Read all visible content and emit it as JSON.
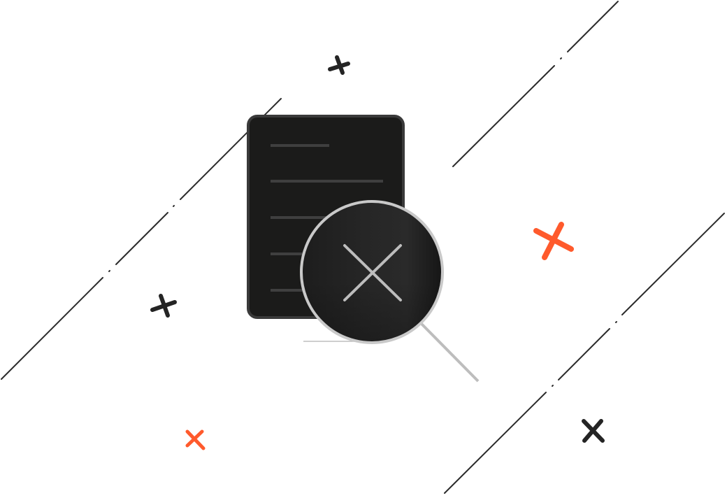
{
  "illustration": {
    "subject": "document-not-found",
    "icons": [
      "document-icon",
      "magnifier-icon",
      "x-mark-icon"
    ]
  },
  "colors": {
    "background": "#ffffff",
    "line": "#2b2b2b",
    "document_fill": "#1b1b1a",
    "document_border": "#3a3a3a",
    "document_text_lines": "#3f3f3f",
    "lens_rim": "#c9c9c9",
    "lens_fill": "#1c1c1c",
    "lens_x": "#bdbdbd",
    "handle": "#bdbdbd",
    "accent": "#ff5a2c",
    "dark_mark": "#242424"
  }
}
